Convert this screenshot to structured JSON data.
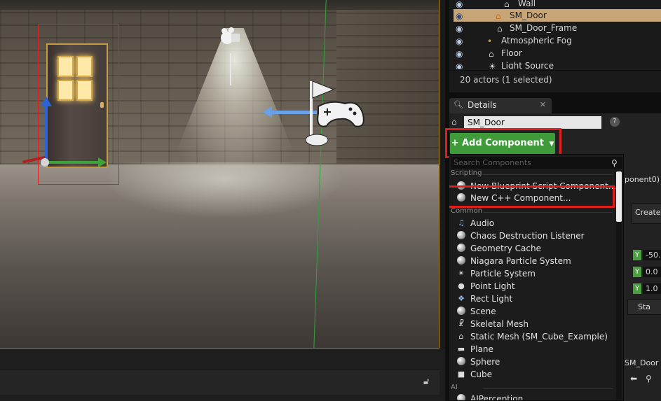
{
  "outliner": {
    "rows": [
      {
        "label": "Wall"
      },
      {
        "label": "SM_Door"
      },
      {
        "label": "SM_Door_Frame"
      },
      {
        "label": "Atmospheric Fog"
      },
      {
        "label": "Floor"
      },
      {
        "label": "Light Source"
      }
    ],
    "status": "20 actors (1 selected)"
  },
  "details": {
    "tab_label": "Details",
    "actor_name": "SM_Door",
    "add_component_label": "+ Add Component",
    "behind": {
      "component_text": "ponent0)",
      "create_button": "Create .",
      "y_label": "Y",
      "loc_y": "-50.",
      "rot_y": "0.0",
      "scale_y": "1.0",
      "static_text": "Sta",
      "mesh_name": "SM_Door"
    }
  },
  "dropdown": {
    "search_placeholder": "Search Components",
    "categories": {
      "scripting": "Scripting",
      "common": "Common",
      "ai": "AI"
    },
    "scripting_items": [
      {
        "label": "New Blueprint Script Component..."
      },
      {
        "label": "New C++ Component..."
      }
    ],
    "common_items": [
      {
        "label": "Audio",
        "icon": "audio-icon"
      },
      {
        "label": "Chaos Destruction Listener",
        "icon": "orb-icon"
      },
      {
        "label": "Geometry Cache",
        "icon": "orb-icon"
      },
      {
        "label": "Niagara Particle System",
        "icon": "orb-icon"
      },
      {
        "label": "Particle System",
        "icon": "particle-icon"
      },
      {
        "label": "Point Light",
        "icon": "bulb-icon"
      },
      {
        "label": "Rect Light",
        "icon": "rect-light-icon"
      },
      {
        "label": "Scene",
        "icon": "orb-icon"
      },
      {
        "label": "Skeletal Mesh",
        "icon": "skeleton-icon"
      },
      {
        "label": "Static Mesh  (SM_Cube_Example)",
        "icon": "static-mesh-icon"
      },
      {
        "label": "Plane",
        "icon": "plane-icon"
      },
      {
        "label": "Sphere",
        "icon": "sphere-icon"
      },
      {
        "label": "Cube",
        "icon": "cube-icon"
      }
    ],
    "ai_items": [
      {
        "label": "AIPerception",
        "icon": "orb-icon"
      }
    ]
  },
  "colors": {
    "selection": "#c8a577",
    "add_component": "#3f9b3a",
    "highlight_outline": "#e01e1e",
    "viewport_border": "#b48a1e"
  }
}
